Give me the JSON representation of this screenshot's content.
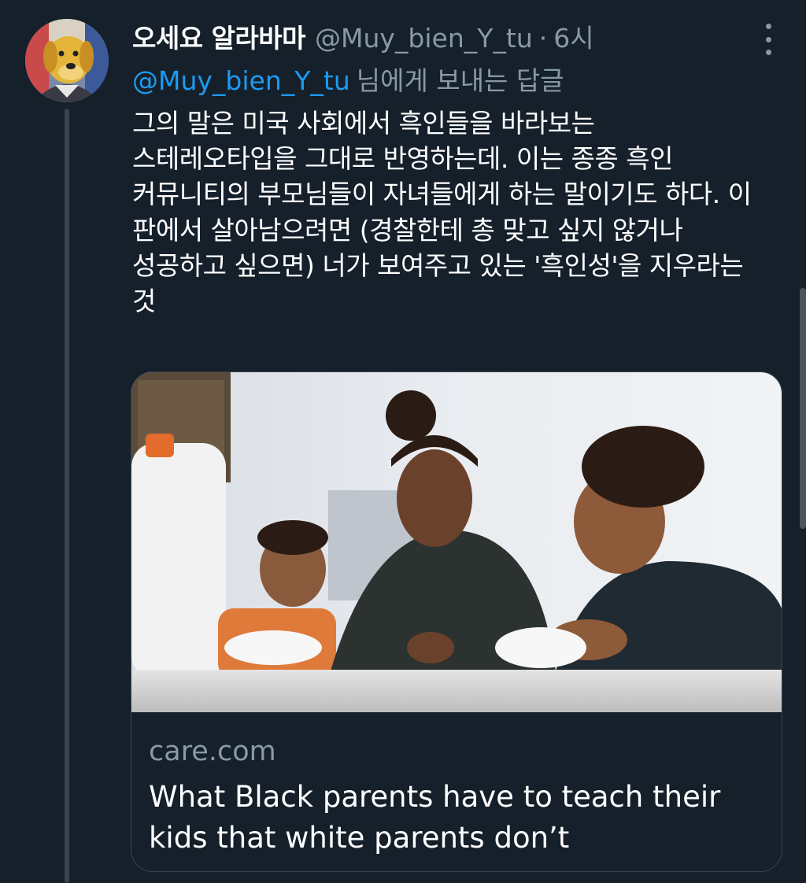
{
  "tweet": {
    "display_name": "오세요 알라바마",
    "handle": "@Muy_bien_Y_tu",
    "separator": "·",
    "time": "6시",
    "reply_to_handle": "@Muy_bien_Y_tu",
    "reply_to_suffix": "님에게 보내는 답글",
    "body_lines": [
      "그의 말은 미국 사회에서 흑인들을 바라보는",
      "스테레오타입을 그대로 반영하는데. 이는 종종 흑인",
      "커뮤니티의 부모님들이 자녀들에게 하는 말이기도 하다. 이",
      "판에서 살아남으려면 (경찰한테 총 맞고 싶지 않거나",
      "성공하고 싶으면) 너가 보여주고 있는 '흑인성'을 지우라는",
      "것"
    ]
  },
  "card": {
    "domain": "care.com",
    "title": "What Black parents have to teach their kids that white parents don’t"
  },
  "icons": {
    "avatar": "cartoon-dog-avatar",
    "more": "more-options-icon"
  },
  "colors": {
    "background": "#15202b",
    "link": "#1d9bf0",
    "secondary_text": "#8899a6",
    "border": "#38444d"
  }
}
